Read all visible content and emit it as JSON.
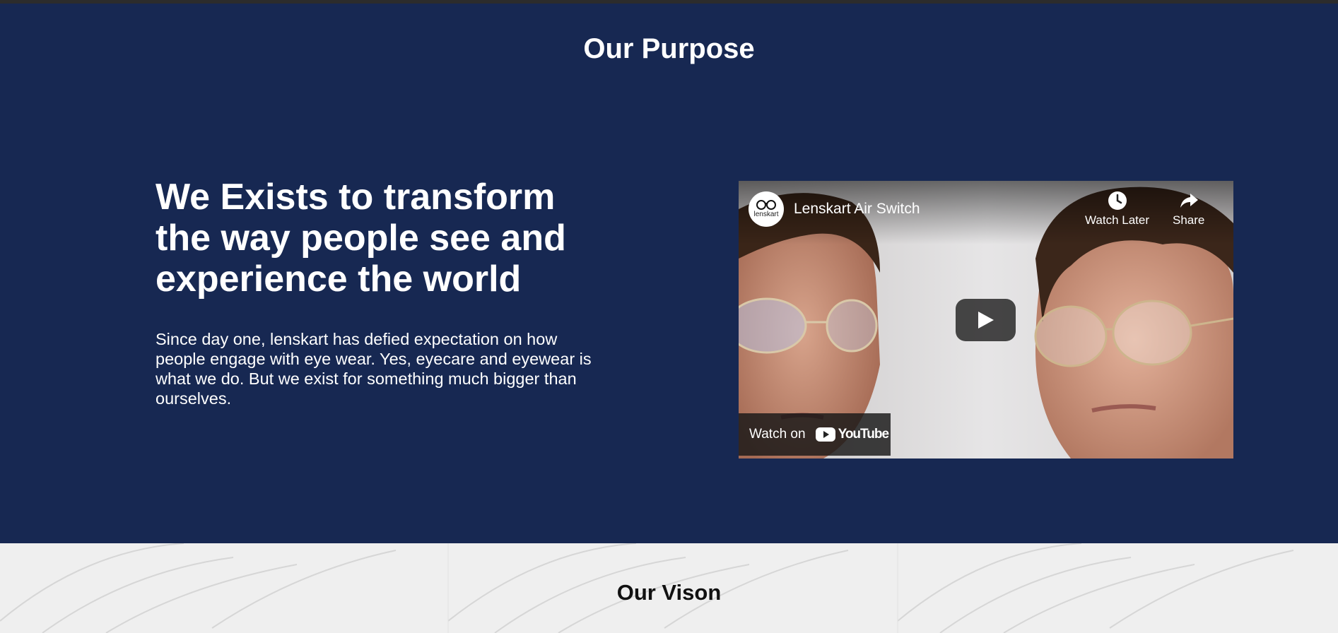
{
  "purpose": {
    "title": "Our Purpose",
    "headline": "We Exists to transform the way people see and experience the world",
    "description": "Since day one, lenskart has defied expectation on how people engage with eye wear. Yes, eyecare and eyewear is what we do. But we exist for something much bigger than ourselves."
  },
  "video": {
    "channel_logo_text": "lenskart",
    "title": "Lenskart Air Switch",
    "watch_later_label": "Watch Later",
    "share_label": "Share",
    "watch_on_label": "Watch on",
    "youtube_label": "YouTube",
    "icons": [
      "clock-icon",
      "share-arrow-icon",
      "play-icon",
      "youtube-logo-icon"
    ]
  },
  "vision": {
    "title": "Our Vison"
  },
  "colors": {
    "page_bg": "#172852",
    "text": "#ffffff",
    "vision_bg": "#efefef"
  }
}
